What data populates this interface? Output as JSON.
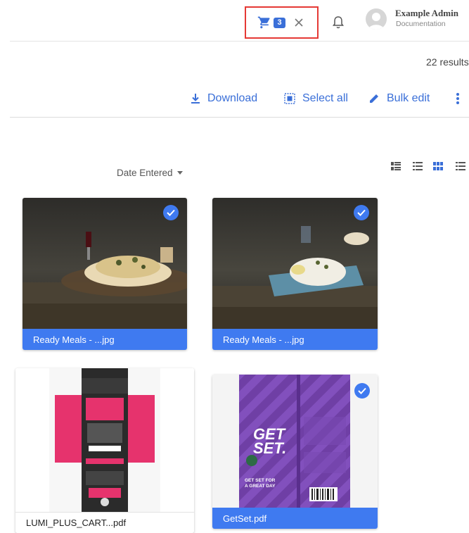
{
  "header": {
    "cart_count": "3",
    "user_name": "Example Admin",
    "user_role": "Documentation"
  },
  "results_text": "22 results",
  "toolbar": {
    "download_label": "Download",
    "select_all_label": "Select all",
    "bulk_edit_label": "Bulk edit"
  },
  "sort": {
    "label": "Date Entered"
  },
  "assets": [
    {
      "caption": "Ready Meals - ...jpg",
      "selected": true
    },
    {
      "caption": "Ready Meals - ...jpg",
      "selected": true
    },
    {
      "caption": "LUMI_PLUS_CART...pdf",
      "selected": false
    },
    {
      "caption": "GetSet.pdf",
      "selected": true
    }
  ],
  "colors": {
    "accent": "#3f7af0",
    "highlight_border": "#e53935"
  },
  "icons": [
    "cart-icon",
    "close-icon",
    "bell-icon",
    "avatar",
    "download-icon",
    "select-all-icon",
    "pencil-icon",
    "more-icon",
    "view-list-icon",
    "view-details-icon",
    "view-grid-icon",
    "view-compact-icon",
    "check-icon"
  ]
}
